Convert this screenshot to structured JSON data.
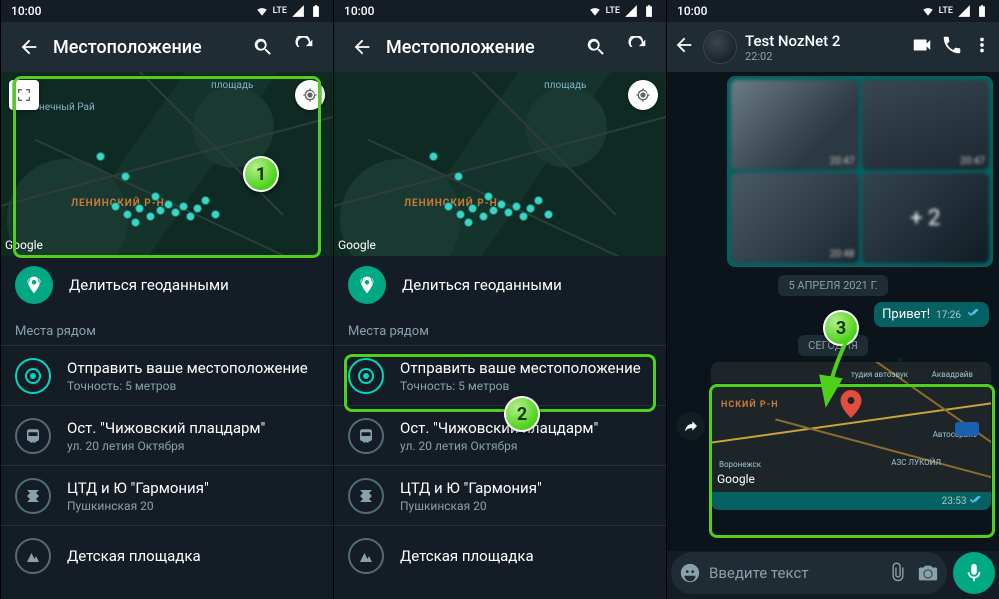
{
  "statusbar": {
    "time": "10:00",
    "network": "LTE",
    "network_sub": "R"
  },
  "panel1": {
    "title": "Местоположение",
    "map": {
      "district": "ЛЕНИНСКИЙ Р-Н",
      "poi1": "площадь",
      "poi2": "нечный Рай",
      "logo": "Google"
    },
    "share_live": "Делиться геоданными",
    "nearby_header": "Места рядом",
    "items": [
      {
        "title": "Отправить ваше местоположение",
        "sub": "Точность: 5 метров"
      },
      {
        "title": "Ост. \"Чижовский плацдарм\"",
        "sub": "ул. 20 летия Октября"
      },
      {
        "title": "ЦТД и Ю \"Гармония\"",
        "sub": "Пушкинская 20"
      },
      {
        "title": "Детская площадка",
        "sub": ""
      }
    ],
    "callout": "1"
  },
  "panel2": {
    "title": "Местоположение",
    "map": {
      "district": "ЛЕНИНСКИЙ Р-Н",
      "poi1": "площадь",
      "logo": "Google"
    },
    "share_live": "Делиться геоданными",
    "nearby_header": "Места рядом",
    "items": [
      {
        "title": "Отправить ваше местоположение",
        "sub": "Точность: 5 метров"
      },
      {
        "title": "Ост. \"Чижовский плацдарм\"",
        "sub": "ул. 20 летия Октября"
      },
      {
        "title": "ЦТД и Ю \"Гармония\"",
        "sub": "Пушкинская 20"
      },
      {
        "title": "Детская площадка",
        "sub": ""
      }
    ],
    "callout": "2"
  },
  "panel3": {
    "chat_name": "Test NozNet 2",
    "chat_time": "22:02",
    "media_times": [
      "20:47",
      "20:47",
      "20:48"
    ],
    "media_more": "+ 2",
    "date1": "5 АПРЕЛЯ 2021 Г.",
    "msg1": "Привет!",
    "msg1_time": "17:26",
    "date2": "СЕГОДНЯ",
    "loc_map": {
      "district": "НСКИЙ Р-Н",
      "logo": "Google",
      "poi1": "тудия автозвук",
      "poi2": "Аквадрайв",
      "poi3": "Автосервис",
      "poi4": "АЗС ЛУКОЙЛ",
      "poi5": "Воронежск"
    },
    "loc_time": "23:53",
    "composer": {
      "placeholder": "Введите текст"
    },
    "callout": "3"
  }
}
